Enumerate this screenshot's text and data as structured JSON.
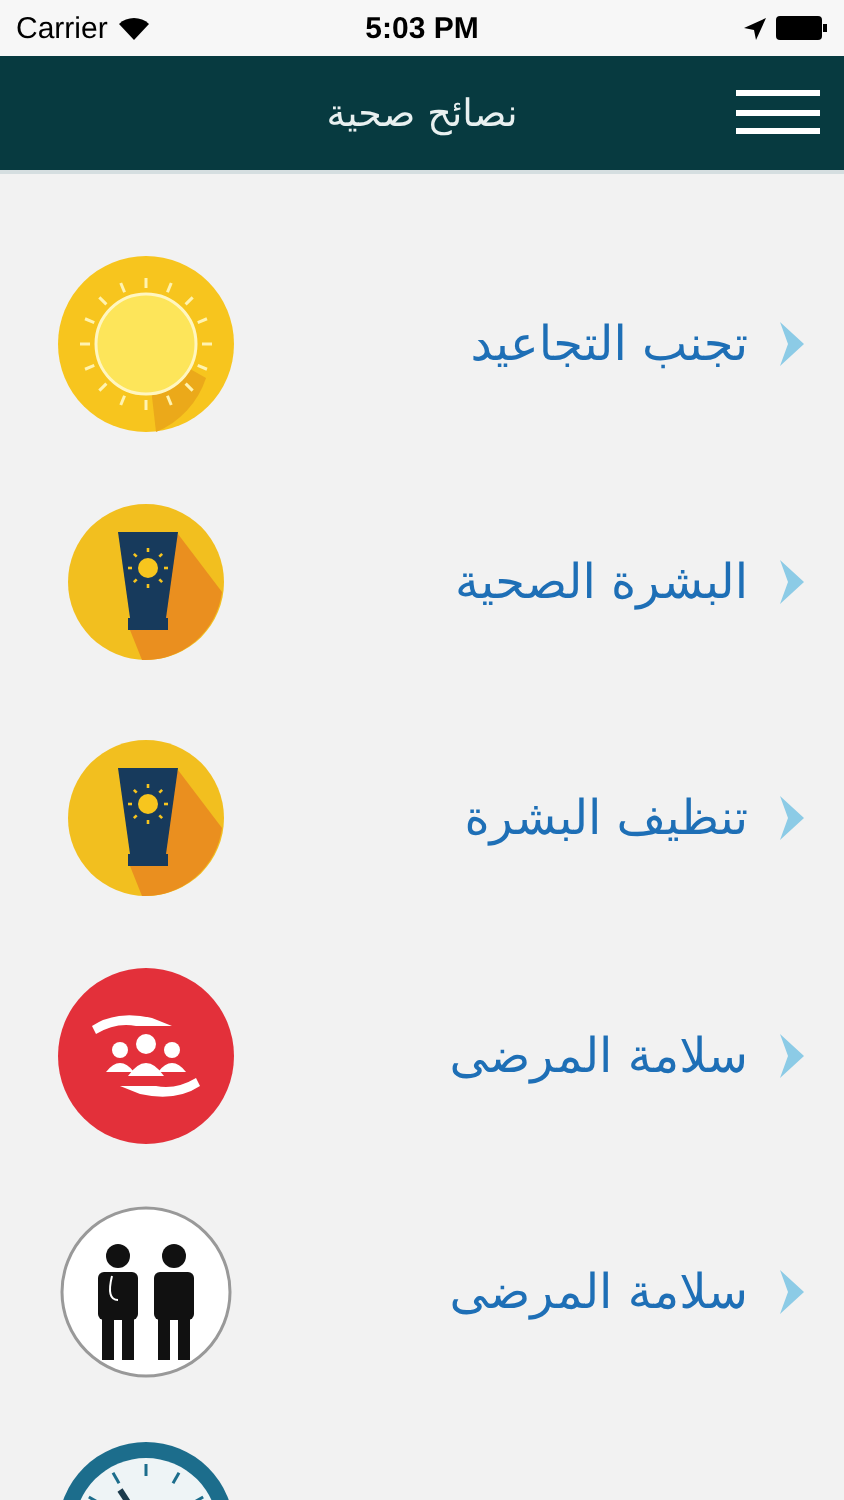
{
  "status_bar": {
    "carrier": "Carrier",
    "time": "5:03 PM"
  },
  "header": {
    "title": "نصائح صحية"
  },
  "items": [
    {
      "kind": "sun",
      "label": "تجنب التجاعيد"
    },
    {
      "kind": "sunscreen",
      "label": "البشرة الصحية"
    },
    {
      "kind": "sunscreen",
      "label": "تنظيف البشرة"
    },
    {
      "kind": "care",
      "label": "سلامة المرضى"
    },
    {
      "kind": "staff",
      "label": "سلامة المرضى"
    },
    {
      "kind": "clock"
    }
  ]
}
